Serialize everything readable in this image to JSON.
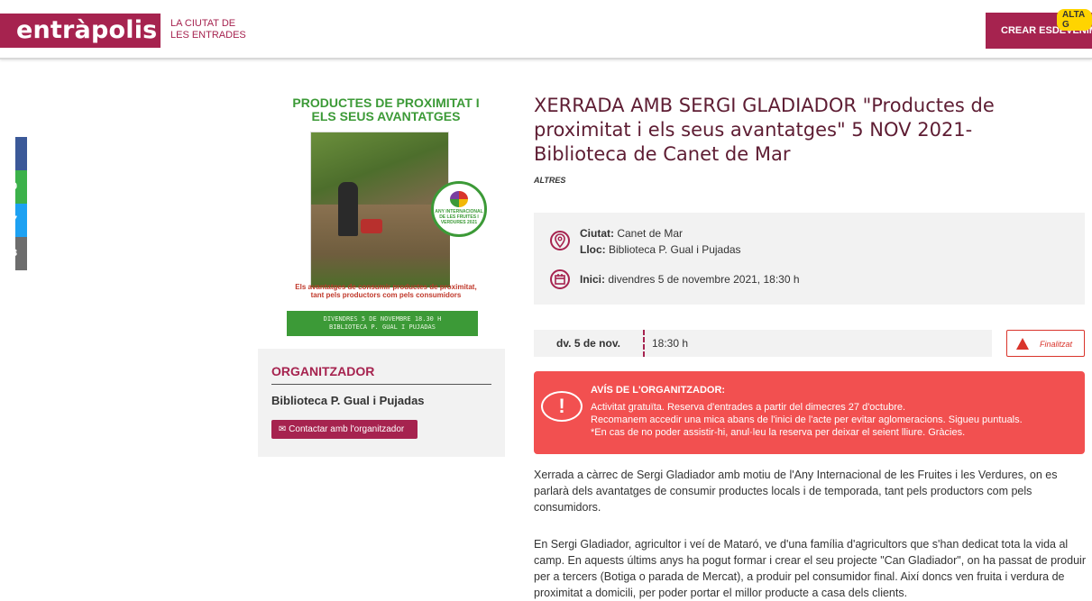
{
  "header": {
    "logo": "entràpolis!",
    "tagline_line1": "LA CIUTAT DE",
    "tagline_line2": "LES ENTRADES",
    "create_button": "CREAR ESDEVENIMENT",
    "badge": "ALTA G"
  },
  "share": [
    {
      "icon": "facebook-icon",
      "color": "#3b5998",
      "glyph": "f"
    },
    {
      "icon": "whatsapp-icon",
      "color": "#3cb14a",
      "glyph": "0"
    },
    {
      "icon": "twitter-icon",
      "color": "#1da1f2",
      "glyph": "7"
    },
    {
      "icon": "email-icon",
      "color": "#6d6d6d",
      "glyph": "3"
    }
  ],
  "poster": {
    "title_line1": "PRODUCTES DE PROXIMITAT I",
    "title_line2": "ELS SEUS AVANTATGES",
    "badge_text": "ANY INTERNACIONAL DE LES FRUITES I VERDURES 2021",
    "caption_line1": "Els avantatges de consumir productes de proximitat,",
    "caption_line2": "tant pels productors com pels consumidors",
    "band_line1": "DIVENDRES 5 DE NOVEMBRE 18.30 H",
    "band_line2": "BIBLIOTECA P. GUAL I PUJADAS"
  },
  "organizer": {
    "heading": "ORGANITZADOR",
    "name": "Biblioteca P. Gual i Pujadas",
    "contact_button": "✉ Contactar amb l'organitzador"
  },
  "event": {
    "title": "XERRADA AMB SERGI GLADIADOR \"Productes de proximitat i els seus avantatges\" 5 NOV 2021- Biblioteca de Canet de Mar",
    "category": "ALTRES",
    "city_label": "Ciutat:",
    "city": "Canet de Mar",
    "venue_label": "Lloc:",
    "venue": "Biblioteca P. Gual i Pujadas",
    "start_label": "Inici:",
    "start": "divendres 5 de novembre 2021, 18:30 h",
    "date_day": "dv. 5 de nov.",
    "date_time": "18:30 h",
    "status": "Finalitzat"
  },
  "notice": {
    "heading": "AVÍS DE L'ORGANITZADOR:",
    "line1": "Activitat gratuïta. Reserva d'entrades a partir del dimecres 27 d'octubre.",
    "line2": "Recomanem accedir una mica abans de l'inici de l'acte per evitar aglomeracions. Sigueu puntuals.",
    "line3": "*En cas de no poder assistir-hi, anul·leu la reserva per deixar el seient lliure. Gràcies."
  },
  "description": {
    "p1": "Xerrada a càrrec de Sergi Gladiador amb motiu de l'Any Internacional de les Fruites i les Verdures, on es parlarà dels avantatges de consumir productes locals i de temporada, tant pels productors com pels consumidors.",
    "p2": "En Sergi Gladiador, agricultor i veí de Mataró, ve d'una família d'agricultors que s'han dedicat tota la vida al camp. En aquests últims anys ha pogut formar i crear el seu projecte \"Can Gladiador\", on ha passat de produir per a tercers (Botiga o parada de Mercat), a produir pel consumidor final. Així doncs ven fruita i verdura de proximitat a domicili, per poder portar el millor producte a casa dels clients."
  }
}
